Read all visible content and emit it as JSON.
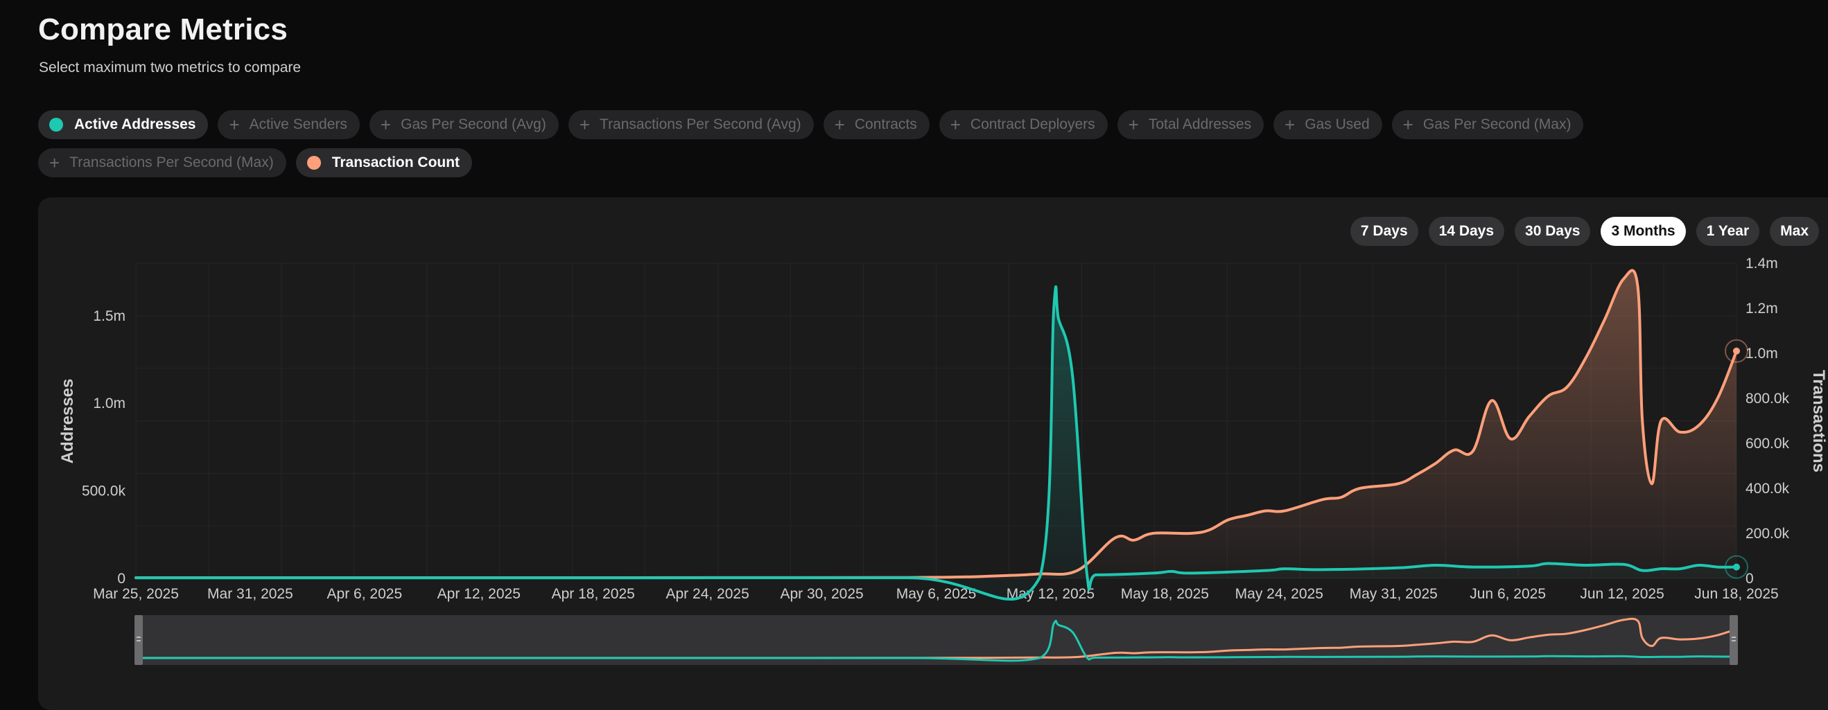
{
  "header": {
    "title": "Compare Metrics",
    "subtitle": "Select maximum two metrics to compare"
  },
  "metrics": [
    {
      "label": "Active Addresses",
      "active": true,
      "color": "#1fc8b1"
    },
    {
      "label": "Active Senders",
      "active": false
    },
    {
      "label": "Gas Per Second (Avg)",
      "active": false
    },
    {
      "label": "Transactions Per Second (Avg)",
      "active": false
    },
    {
      "label": "Contracts",
      "active": false
    },
    {
      "label": "Contract Deployers",
      "active": false
    },
    {
      "label": "Total Addresses",
      "active": false
    },
    {
      "label": "Gas Used",
      "active": false
    },
    {
      "label": "Gas Per Second (Max)",
      "active": false
    },
    {
      "label": "Transactions Per Second (Max)",
      "active": false
    },
    {
      "label": "Transaction Count",
      "active": true,
      "color": "#ffa07a"
    }
  ],
  "time_ranges": {
    "options": [
      "7 Days",
      "14 Days",
      "30 Days",
      "3 Months",
      "1 Year",
      "Max"
    ],
    "selected": "3 Months"
  },
  "colors": {
    "teal": "#1fc8b1",
    "orange": "#ffa07a"
  },
  "chart_data": {
    "type": "line",
    "x_ticks": [
      "Mar 25, 2025",
      "Mar 31, 2025",
      "Apr 6, 2025",
      "Apr 12, 2025",
      "Apr 18, 2025",
      "Apr 24, 2025",
      "Apr 30, 2025",
      "May 6, 2025",
      "May 12, 2025",
      "May 18, 2025",
      "May 24, 2025",
      "May 31, 2025",
      "Jun 6, 2025",
      "Jun 12, 2025",
      "Jun 18, 2025"
    ],
    "x_range": [
      "2025-03-25",
      "2025-06-18"
    ],
    "left_axis": {
      "label": "Addresses",
      "ticks": [
        "0",
        "500.0k",
        "1.0m",
        "1.5m"
      ],
      "tick_values": [
        0,
        500000,
        1000000,
        1500000
      ],
      "range": [
        0,
        1800000
      ]
    },
    "right_axis": {
      "label": "Transactions",
      "ticks": [
        "0",
        "200.0k",
        "400.0k",
        "600.0k",
        "800.0k",
        "1.0m",
        "1.2m",
        "1.4m"
      ],
      "tick_values": [
        0,
        200000,
        400000,
        600000,
        800000,
        1000000,
        1200000,
        1400000
      ],
      "range": [
        0,
        1400000
      ]
    },
    "series": [
      {
        "name": "Active Addresses",
        "axis": "left",
        "color": "#1fc8b1",
        "points": [
          [
            "2025-03-25",
            3000
          ],
          [
            "2025-04-05",
            3000
          ],
          [
            "2025-04-20",
            3000
          ],
          [
            "2025-05-05",
            3500
          ],
          [
            "2025-05-12",
            5000
          ],
          [
            "2025-05-12T18:00",
            1550000
          ],
          [
            "2025-05-13",
            1480000
          ],
          [
            "2025-05-13T18:00",
            1150000
          ],
          [
            "2025-05-14T12:00",
            30000
          ],
          [
            "2025-05-15",
            20000
          ],
          [
            "2025-05-18",
            30000
          ],
          [
            "2025-05-19",
            40000
          ],
          [
            "2025-05-20",
            30000
          ],
          [
            "2025-05-24",
            45000
          ],
          [
            "2025-05-25",
            55000
          ],
          [
            "2025-05-27",
            50000
          ],
          [
            "2025-05-31",
            60000
          ],
          [
            "2025-06-02",
            75000
          ],
          [
            "2025-06-04",
            65000
          ],
          [
            "2025-06-07",
            70000
          ],
          [
            "2025-06-08",
            85000
          ],
          [
            "2025-06-10",
            75000
          ],
          [
            "2025-06-12",
            80000
          ],
          [
            "2025-06-13",
            45000
          ],
          [
            "2025-06-14",
            55000
          ],
          [
            "2025-06-15",
            55000
          ],
          [
            "2025-06-16",
            75000
          ],
          [
            "2025-06-17",
            65000
          ],
          [
            "2025-06-18",
            65000
          ]
        ]
      },
      {
        "name": "Transaction Count",
        "axis": "right",
        "color": "#ffa07a",
        "points": [
          [
            "2025-03-25",
            3000
          ],
          [
            "2025-04-15",
            3000
          ],
          [
            "2025-05-05",
            4000
          ],
          [
            "2025-05-10",
            12000
          ],
          [
            "2025-05-12",
            20000
          ],
          [
            "2025-05-14",
            35000
          ],
          [
            "2025-05-16",
            180000
          ],
          [
            "2025-05-17",
            170000
          ],
          [
            "2025-05-18",
            200000
          ],
          [
            "2025-05-20",
            200000
          ],
          [
            "2025-05-21",
            215000
          ],
          [
            "2025-05-22",
            260000
          ],
          [
            "2025-05-23",
            280000
          ],
          [
            "2025-05-24",
            300000
          ],
          [
            "2025-05-25",
            300000
          ],
          [
            "2025-05-27",
            350000
          ],
          [
            "2025-05-28",
            360000
          ],
          [
            "2025-05-29",
            400000
          ],
          [
            "2025-05-31",
            420000
          ],
          [
            "2025-06-01",
            460000
          ],
          [
            "2025-06-02",
            510000
          ],
          [
            "2025-06-03",
            570000
          ],
          [
            "2025-06-04",
            565000
          ],
          [
            "2025-06-05",
            790000
          ],
          [
            "2025-06-06",
            620000
          ],
          [
            "2025-06-07",
            720000
          ],
          [
            "2025-06-08",
            810000
          ],
          [
            "2025-06-09",
            850000
          ],
          [
            "2025-06-10",
            980000
          ],
          [
            "2025-06-11",
            1150000
          ],
          [
            "2025-06-12",
            1330000
          ],
          [
            "2025-06-12T18:00",
            1300000
          ],
          [
            "2025-06-13",
            700000
          ],
          [
            "2025-06-13T12:00",
            420000
          ],
          [
            "2025-06-14",
            700000
          ],
          [
            "2025-06-15",
            650000
          ],
          [
            "2025-06-16",
            680000
          ],
          [
            "2025-06-17",
            800000
          ],
          [
            "2025-06-18",
            1010000
          ]
        ]
      }
    ],
    "grid": true,
    "navigator": true
  }
}
